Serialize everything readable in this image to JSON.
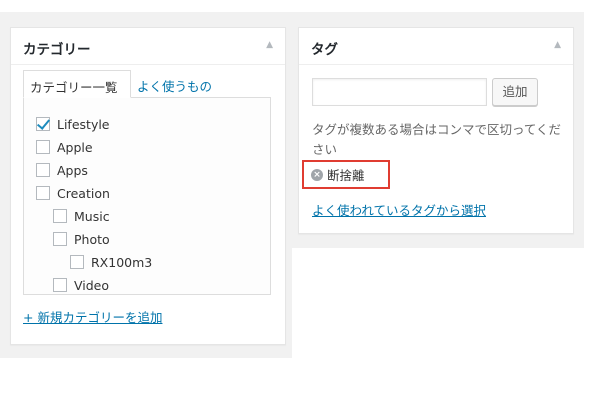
{
  "category_box": {
    "title": "カテゴリー",
    "toggle_icon": "▲",
    "tabs": [
      {
        "label": "カテゴリー一覧",
        "active": true
      },
      {
        "label": "よく使うもの",
        "active": false
      }
    ],
    "items": [
      {
        "label": "Lifestyle",
        "checked": true,
        "level": 0
      },
      {
        "label": "Apple",
        "checked": false,
        "level": 0
      },
      {
        "label": "Apps",
        "checked": false,
        "level": 0
      },
      {
        "label": "Creation",
        "checked": false,
        "level": 0
      },
      {
        "label": "Music",
        "checked": false,
        "level": 1
      },
      {
        "label": "Photo",
        "checked": false,
        "level": 1
      },
      {
        "label": "RX100m3",
        "checked": false,
        "level": 2
      },
      {
        "label": "Video",
        "checked": false,
        "level": 1
      }
    ],
    "add_link": "+ 新規カテゴリーを追加"
  },
  "tag_box": {
    "title": "タグ",
    "toggle_icon": "▲",
    "input_value": "",
    "add_button": "追加",
    "hint": "タグが複数ある場合はコンマで区切ってください",
    "tags": [
      {
        "name": "断捨離",
        "remove_icon": "×"
      }
    ],
    "highlight_color": "#e03c31",
    "popular_link": "よく使われているタグから選択"
  },
  "colors": {
    "link": "#0073aa",
    "check": "#1e8cbe"
  }
}
